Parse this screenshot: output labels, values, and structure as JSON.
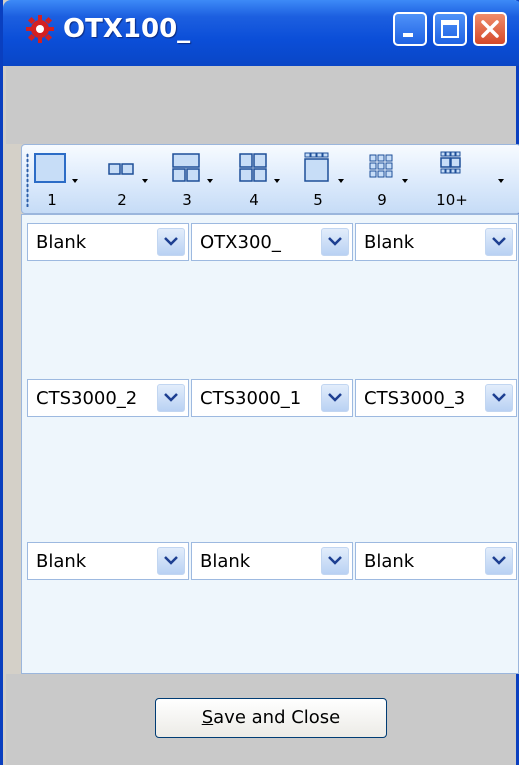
{
  "window": {
    "title": "OTX100_",
    "controls": [
      "minimize",
      "maximize",
      "close"
    ]
  },
  "toolbar": {
    "layouts": [
      {
        "label": "1",
        "icon": "single-pane-icon"
      },
      {
        "label": "2",
        "icon": "two-pane-icon"
      },
      {
        "label": "3",
        "icon": "three-pane-icon"
      },
      {
        "label": "4",
        "icon": "four-pane-icon"
      },
      {
        "label": "5",
        "icon": "five-pane-icon"
      },
      {
        "label": "9",
        "icon": "nine-pane-icon"
      },
      {
        "label": "10+",
        "icon": "ten-plus-pane-icon"
      }
    ]
  },
  "grid": {
    "rows": [
      [
        "Blank",
        "OTX300_",
        "Blank"
      ],
      [
        "CTS3000_2",
        "CTS3000_1",
        "CTS3000_3"
      ],
      [
        "Blank",
        "Blank",
        "Blank"
      ]
    ]
  },
  "footer": {
    "save_prefix": "S",
    "save_rest": "ave and Close"
  }
}
